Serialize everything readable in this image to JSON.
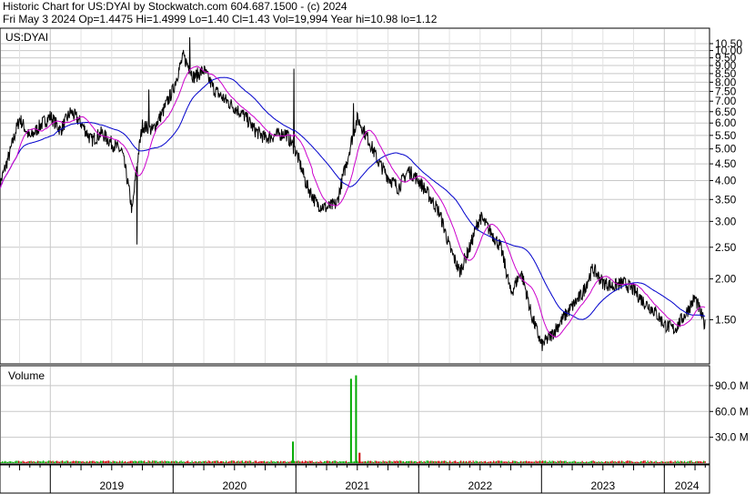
{
  "header": {
    "line1": "Historic Chart for US:DYAI by Stockwatch.com 604.687.1500 - (c) 2024",
    "line2": "Fri May  3 2024   Op=1.4475   Hi=1.4999   Lo=1.40   Cl=1.43   Vol=19,994   Year hi=10.98   lo=1.12"
  },
  "chart_data": [
    {
      "type": "line",
      "title": "US:DYAI",
      "series": [],
      "x_axis_labels": [
        "2019",
        "2020",
        "2021",
        "2022",
        "2023",
        "2024"
      ],
      "ylim": [
        1.12,
        10.98
      ],
      "y_scale": "log",
      "y_ticks": [
        "10.50",
        "10.00",
        "9.50",
        "9.00",
        "8.50",
        "8.00",
        "7.50",
        "7.00",
        "6.50",
        "6.00",
        "5.50",
        "5.00",
        "4.50",
        "4.00",
        "3.50",
        "3.00",
        "2.50",
        "2.00",
        "1.50"
      ],
      "price_path": [
        [
          "2018-08-01",
          3.8
        ],
        [
          "2018-09-01",
          4.8
        ],
        [
          "2018-10-01",
          6.2
        ],
        [
          "2018-11-01",
          5.4
        ],
        [
          "2018-12-01",
          5.9
        ],
        [
          "2019-01-01",
          6.3
        ],
        [
          "2019-02-01",
          5.7
        ],
        [
          "2019-03-01",
          6.5
        ],
        [
          "2019-04-01",
          6.0
        ],
        [
          "2019-05-01",
          5.3
        ],
        [
          "2019-06-01",
          5.6
        ],
        [
          "2019-07-01",
          5.2
        ],
        [
          "2019-08-01",
          4.9
        ],
        [
          "2019-09-01",
          3.2
        ],
        [
          "2019-10-01",
          5.9
        ],
        [
          "2019-11-01",
          5.7
        ],
        [
          "2019-12-01",
          6.5
        ],
        [
          "2020-01-01",
          7.6
        ],
        [
          "2020-02-01",
          9.6
        ],
        [
          "2020-03-01",
          8.3
        ],
        [
          "2020-04-01",
          8.7
        ],
        [
          "2020-05-01",
          7.6
        ],
        [
          "2020-06-01",
          7.1
        ],
        [
          "2020-07-01",
          6.7
        ],
        [
          "2020-08-01",
          6.3
        ],
        [
          "2020-09-01",
          5.7
        ],
        [
          "2020-10-01",
          5.4
        ],
        [
          "2020-11-01",
          5.5
        ],
        [
          "2020-12-01",
          5.6
        ],
        [
          "2021-01-01",
          4.9
        ],
        [
          "2021-02-01",
          3.9
        ],
        [
          "2021-03-01",
          3.4
        ],
        [
          "2021-04-01",
          3.3
        ],
        [
          "2021-05-01",
          3.4
        ],
        [
          "2021-06-01",
          4.6
        ],
        [
          "2021-07-01",
          6.2
        ],
        [
          "2021-08-01",
          5.4
        ],
        [
          "2021-09-01",
          4.6
        ],
        [
          "2021-10-01",
          4.1
        ],
        [
          "2021-11-01",
          3.8
        ],
        [
          "2021-12-01",
          4.3
        ],
        [
          "2022-01-01",
          4.0
        ],
        [
          "2022-02-01",
          3.6
        ],
        [
          "2022-03-01",
          3.2
        ],
        [
          "2022-04-01",
          2.5
        ],
        [
          "2022-05-01",
          2.1
        ],
        [
          "2022-06-01",
          2.5
        ],
        [
          "2022-07-01",
          3.1
        ],
        [
          "2022-08-01",
          2.8
        ],
        [
          "2022-09-01",
          2.5
        ],
        [
          "2022-10-01",
          1.8
        ],
        [
          "2022-11-01",
          2.1
        ],
        [
          "2022-12-01",
          1.55
        ],
        [
          "2023-01-01",
          1.25
        ],
        [
          "2023-02-01",
          1.35
        ],
        [
          "2023-03-01",
          1.5
        ],
        [
          "2023-04-01",
          1.65
        ],
        [
          "2023-05-01",
          1.8
        ],
        [
          "2023-06-01",
          2.15
        ],
        [
          "2023-07-01",
          1.95
        ],
        [
          "2023-08-01",
          1.9
        ],
        [
          "2023-09-01",
          1.95
        ],
        [
          "2023-10-01",
          1.85
        ],
        [
          "2023-11-01",
          1.7
        ],
        [
          "2023-12-01",
          1.6
        ],
        [
          "2024-01-01",
          1.45
        ],
        [
          "2024-02-01",
          1.4
        ],
        [
          "2024-03-01",
          1.55
        ],
        [
          "2024-04-01",
          1.75
        ],
        [
          "2024-05-01",
          1.43
        ]
      ],
      "moving_average_colors": {
        "short": "#cc00cc",
        "long": "#0000cc"
      },
      "price_color": "#000000",
      "grid": true
    },
    {
      "type": "bar",
      "title": "Volume",
      "series": [],
      "y_ticks": [
        "90.0 M",
        "60.0 M",
        "30.0 M"
      ],
      "ylim": [
        0,
        110
      ],
      "volume_spikes": [
        [
          "2020-05-20",
          2,
          "#cc0000"
        ],
        [
          "2020-12-20",
          25,
          "#00aa00"
        ],
        [
          "2021-06-10",
          98,
          "#00aa00"
        ],
        [
          "2021-06-25",
          102,
          "#00aa00"
        ],
        [
          "2021-07-05",
          12,
          "#cc0000"
        ]
      ],
      "up_color": "#00aa00",
      "down_color": "#cc0000",
      "grid": true
    }
  ]
}
